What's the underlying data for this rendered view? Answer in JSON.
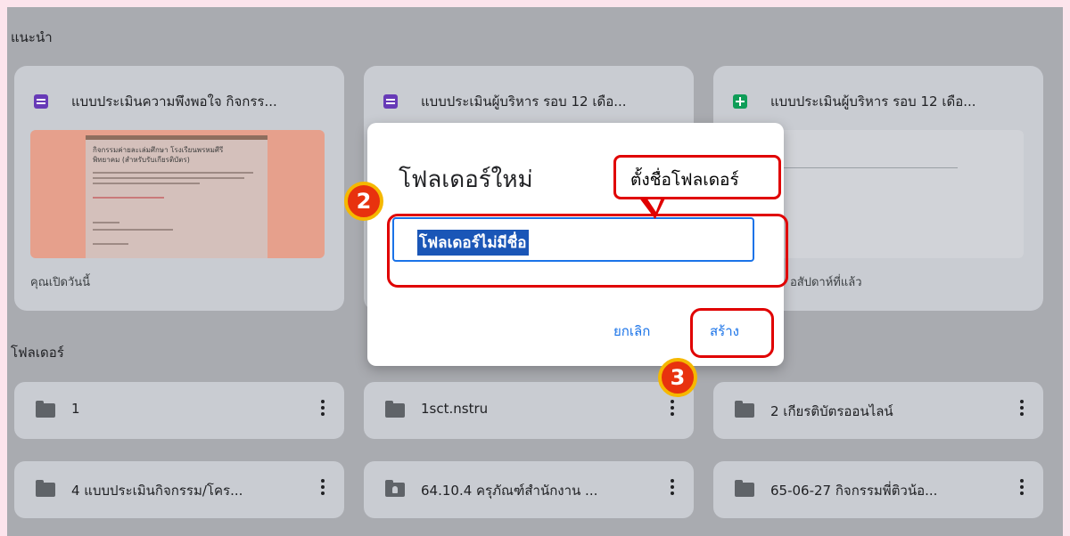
{
  "suggested": {
    "label": "แนะนำ",
    "cards": [
      {
        "title": "แบบประเมินความพึงพอใจ กิจกรร...",
        "icon": "google-forms-icon",
        "footer": "คุณเปิดวันนี้",
        "preview_title": "กิจกรรมค่ายละเล่มศึกษา โรงเรียนพรหมศีรี",
        "preview_subtitle": "พิทยาคม (สำหรับรับเกียรติบัตร)"
      },
      {
        "title": "แบบประเมินผู้บริหาร รอบ 12 เดือ...",
        "icon": "google-forms-icon",
        "footer": ""
      },
      {
        "title": "แบบประเมินผู้บริหาร รอบ 12 เดือ...",
        "icon": "google-sheets-icon",
        "footer": "อสัปดาห์ที่แล้ว"
      }
    ]
  },
  "folders": {
    "label": "โฟลเดอร์",
    "items": [
      {
        "name": "1",
        "icon": "folder-icon"
      },
      {
        "name": "1sct.nstru",
        "icon": "folder-icon"
      },
      {
        "name": "2 เกียรติบัตรออนไลน์",
        "icon": "folder-icon"
      },
      {
        "name": "4 แบบประเมินกิจกรรม/โคร...",
        "icon": "folder-icon"
      },
      {
        "name": "64.10.4 ครุภัณฑ์สำนักงาน ...",
        "icon": "shared-folder-icon"
      },
      {
        "name": "65-06-27 กิจกรรมพี่ติวน้อ...",
        "icon": "folder-icon"
      }
    ]
  },
  "dialog": {
    "title": "โฟลเดอร์ใหม่",
    "input_value": "โฟลเดอร์ไม่มีชื่อ",
    "cancel_label": "ยกเลิก",
    "create_label": "สร้าง"
  },
  "annotations": {
    "callout_text": "ตั้งชื่อโฟลเดอร์",
    "step2": "2",
    "step3": "3"
  },
  "colors": {
    "accent": "#1a73e8",
    "annotation_red": "#e00000",
    "badge_fill": "#e8320e",
    "badge_ring": "#f5b800",
    "forms_purple": "#673ab7",
    "sheets_green": "#0f9d58"
  }
}
